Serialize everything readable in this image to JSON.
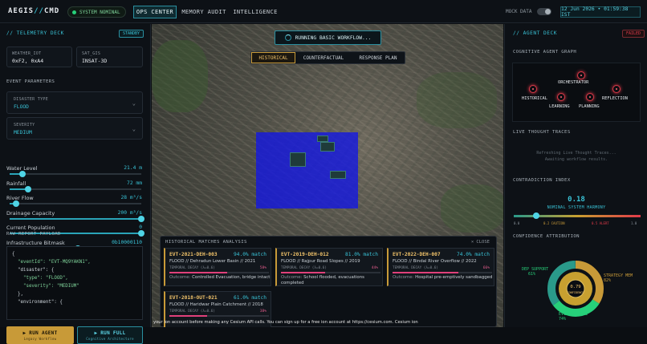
{
  "app": {
    "logo_left": "AEGIS",
    "logo_sep": "//",
    "logo_right": "CMD",
    "status": "SYSTEM NOMINAL"
  },
  "nav": {
    "tabs": [
      "OPS CENTER",
      "MEMORY AUDIT",
      "INTELLIGENCE"
    ],
    "active": "OPS CENTER",
    "mock_label": "MOCK DATA",
    "mock_on": false,
    "clock": "12 Jun 2026 • 01:59:38 IST"
  },
  "telemetry": {
    "title": "// TELEMETRY DECK",
    "badge": "STANDBY",
    "weather_label": "WEATHER_IOT",
    "weather_value": "0xF2, 0xA4",
    "sat_label": "SAT_GIS",
    "sat_value": "INSAT-3D",
    "event_params": "EVENT PARAMETERS",
    "disaster_label": "DISASTER TYPE",
    "disaster_value": "FLOOD",
    "severity_label": "SEVERITY",
    "severity_value": "MEDIUM",
    "sliders": [
      {
        "name": "Water Level",
        "value": "21.4 m",
        "level": 0.1
      },
      {
        "name": "Rainfall",
        "value": "72 mm",
        "level": 0.14
      },
      {
        "name": "River Flow",
        "value": "28 m³/s",
        "level": 0.05
      },
      {
        "name": "Drainage Capacity",
        "value": "200 m³/s",
        "level": 1.0
      },
      {
        "name": "Current Population",
        "value": "0",
        "level": 1.0
      },
      {
        "name": "Infrastructure Bitmask",
        "value": "0b10000110",
        "level": 0.52
      }
    ],
    "raw_title": "RAW REPORT PAYLOAD",
    "json_lines": [
      "{",
      "  \"eventId\": \"EVT-MQ9YAKN1\",",
      "  \"disaster\": {",
      "    \"type\": \"FLOOD\",",
      "    \"severity\": \"MEDIUM\"",
      "  },",
      "  \"environment\": {"
    ],
    "run_agent": "▶ RUN AGENT",
    "run_agent_sub": "Legacy Workflow",
    "run_full": "▶ RUN FULL",
    "run_full_sub": "Cognitive Architecture"
  },
  "map": {
    "running": "RUNNING BASIC WORKFLOW...",
    "tabs": [
      "HISTORICAL",
      "COUNTERFACTUAL",
      "RESPONSE PLAN"
    ],
    "active_tab": "HISTORICAL",
    "hist_title": "HISTORICAL MATCHES ANALYSIS",
    "close": "× CLOSE",
    "events": [
      {
        "id": "EVT-2021-DEH-003",
        "match": "94.0% match",
        "desc": "FLOOD // Dehradun Lower Basin // 2021",
        "decay_label": "TEMPORAL DECAY (λ=0.6)",
        "decay_pct": "58%",
        "decay": 0.58,
        "outcome_label": "Outcome:",
        "outcome": "Controlled Evacuation, bridge intact"
      },
      {
        "id": "EVT-2019-DEH-012",
        "match": "81.0% match",
        "desc": "FLOOD // Rajpur Road Slopes // 2019",
        "decay_label": "TEMPORAL DECAY (λ=0.6)",
        "decay_pct": "44%",
        "decay": 0.44,
        "outcome_label": "Outcome:",
        "outcome": "School flooded, evacuations completed"
      },
      {
        "id": "EVT-2022-DEH-007",
        "match": "74.0% match",
        "desc": "FLOOD // Bindal River Overflow // 2022",
        "decay_label": "TEMPORAL DECAY (λ=0.6)",
        "decay_pct": "66%",
        "decay": 0.66,
        "outcome_label": "Outcome:",
        "outcome": "Hospital pre-emptively sandbagged"
      },
      {
        "id": "EVT-2018-OUT-021",
        "match": "61.0% match",
        "desc": "FLOOD // Haridwar Plain Catchment // 2018",
        "decay_label": "TEMPORAL DECAY (λ=0.6)",
        "decay_pct": "38%",
        "decay": 0.38,
        "outcome_label": "",
        "outcome": ""
      }
    ],
    "cesium_note": "your ion account before making any Cesium API calls. You can sign up for a free ion account at https://cesium.com. Cesium ion"
  },
  "agent": {
    "title": "// AGENT DECK",
    "badge": "FAILED",
    "graph_title": "COGNITIVE AGENT GRAPH",
    "nodes": [
      "ORCHESTRATOR",
      "HISTORICAL",
      "LEARNING",
      "PLANNING",
      "REFLECTION"
    ],
    "traces_title": "LIVE THOUGHT TRACES",
    "traces_l1": "Refreshing Live Thought Traces...",
    "traces_l2": "Awaiting workflow results.",
    "contradiction_title": "CONTRADICTION INDEX",
    "index": "0.18",
    "index_value": 0.18,
    "harmony": "NOMINAL SYSTEM HARMONY",
    "ticks": [
      "0.0",
      "0.2 CAUTION",
      "0.5 ALERT",
      "1.0"
    ],
    "confidence_title": "CONFIDENCE ATTRIBUTION",
    "conf_labels": [
      {
        "name": "DEP SUPPORT",
        "pct": "61%"
      },
      {
        "name": "STRATEGY MEM",
        "pct": "82%"
      },
      {
        "name": "EVIDENCE REL",
        "pct": "74%"
      }
    ],
    "center_val": "0.79",
    "center_lbl": "CONFIDENCE",
    "colors": {
      "accent": "#39c2d6",
      "gold": "#c89a38",
      "fail": "#e23a4a",
      "green": "#27d07a"
    }
  }
}
